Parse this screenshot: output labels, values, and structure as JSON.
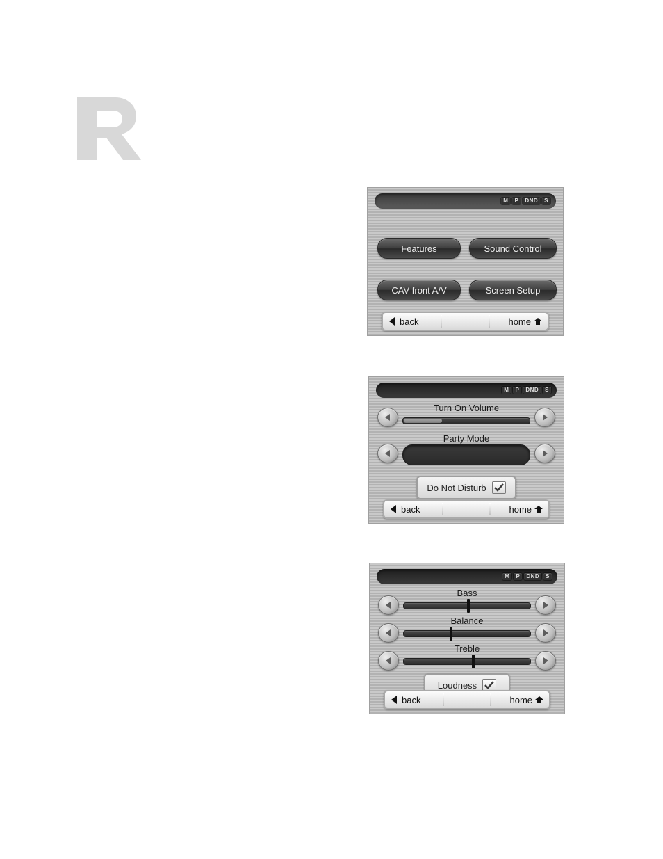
{
  "status_icons": [
    "M",
    "P",
    "DND",
    "S"
  ],
  "screen1": {
    "buttons": {
      "features": "Features",
      "sound_control": "Sound Control",
      "cav": "CAV front A/V",
      "screen_setup": "Screen Setup"
    }
  },
  "screen2": {
    "turn_on_volume": {
      "label": "Turn On Volume",
      "value_pct": 30
    },
    "party_mode": {
      "label": "Party Mode"
    },
    "dnd": {
      "label": "Do Not Disturb",
      "checked": true
    }
  },
  "screen3": {
    "bass": {
      "label": "Bass",
      "value_pct": 50
    },
    "balance": {
      "label": "Balance",
      "value_pct": 36
    },
    "treble": {
      "label": "Treble",
      "value_pct": 54
    },
    "loudness": {
      "label": "Loudness",
      "checked": true
    }
  },
  "nav": {
    "back": "back",
    "home": "home"
  }
}
